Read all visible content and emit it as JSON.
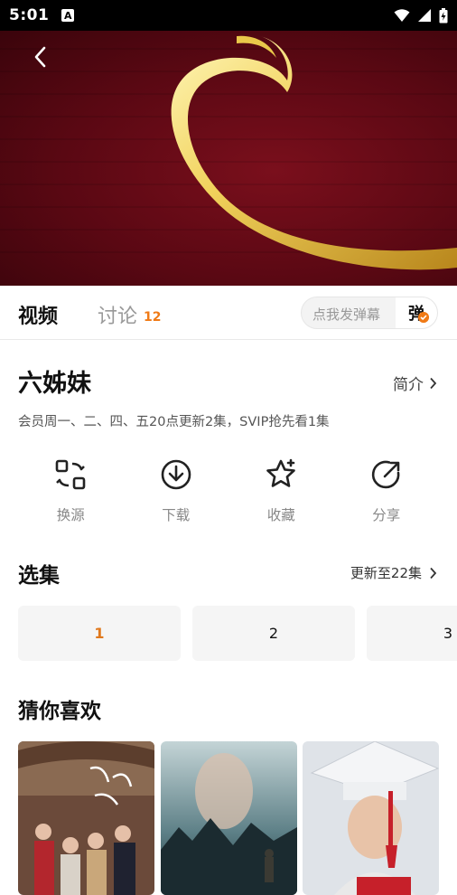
{
  "status_bar": {
    "time": "5:01",
    "notification": "A"
  },
  "tabs": {
    "video": "视频",
    "discuss": "讨论",
    "discuss_count": "12"
  },
  "danmaku": {
    "placeholder": "点我发弹幕",
    "button": "弹"
  },
  "show": {
    "title": "六姊妹",
    "intro_label": "简介",
    "schedule": "会员周一、二、四、五20点更新2集，SVIP抢先看1集"
  },
  "actions": [
    {
      "label": "换源",
      "icon": "switch-source-icon"
    },
    {
      "label": "下载",
      "icon": "download-icon"
    },
    {
      "label": "收藏",
      "icon": "star-icon"
    },
    {
      "label": "分享",
      "icon": "share-icon"
    }
  ],
  "episodes": {
    "header": "选集",
    "update_text": "更新至22集",
    "items": [
      "1",
      "2",
      "3"
    ]
  },
  "recommend": {
    "header": "猜你喜欢"
  },
  "colors": {
    "accent": "#f07a16",
    "hero_bg": "#5a0813"
  }
}
